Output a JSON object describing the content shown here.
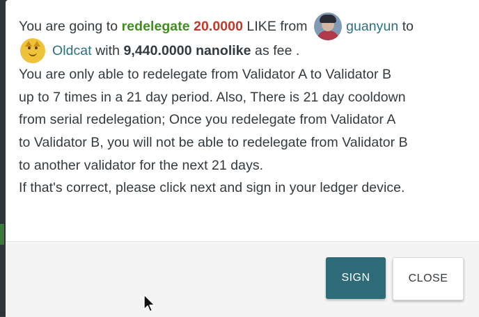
{
  "dialog": {
    "line1": {
      "pre": "You are going to ",
      "action": "redelegate",
      "amount": " 20.0000",
      "unit": " LIKE from ",
      "from_validator": "guanyun",
      "to": " to"
    },
    "line2": {
      "to_validator": "Oldcat",
      "with": " with ",
      "fee_amount": "9,440.0000 nanolike",
      "fee_suffix": " as fee ."
    },
    "paragraph": [
      "You are only able to redelegate from Validator A to Validator B",
      "up to 7 times in a 21 day period. Also, There is 21 day cooldown",
      "from serial redelegation; Once you redelegate from Validator A",
      "to Validator B, you will not be able to redelegate from Validator B",
      "to another validator for the next 21 days.",
      "If that's correct, please click next and sign in your ledger device."
    ]
  },
  "buttons": {
    "sign": "SIGN",
    "close": "CLOSE"
  },
  "colors": {
    "accent_green": "#3f8f1f",
    "accent_red": "#c0392b",
    "link_teal": "#2b6f82",
    "primary_button": "#2e6b78"
  },
  "icons": {
    "from_avatar": "guanyun-avatar",
    "to_avatar": "oldcat-avatar",
    "pointer": "mouse-cursor-icon"
  }
}
